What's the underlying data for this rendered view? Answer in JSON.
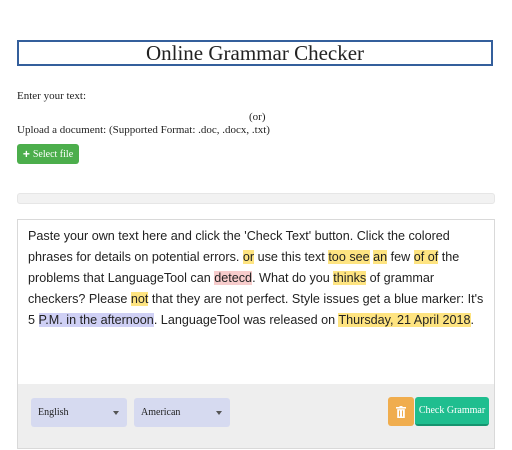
{
  "header": {
    "title": "Online Grammar Checker"
  },
  "input": {
    "enter_label": "Enter your text:",
    "or_label": "(or)",
    "upload_label": "Upload a document: (Supported Format: .doc, .docx, .txt)",
    "select_file_label": "Select file"
  },
  "editor": {
    "segments": [
      {
        "text": "Paste your own text here and click the 'Check Text' button. Click the colored phrases for details on potential errors. ",
        "hl": "none"
      },
      {
        "text": "or",
        "hl": "grammar"
      },
      {
        "text": " use this text ",
        "hl": "none"
      },
      {
        "text": "too see",
        "hl": "grammar"
      },
      {
        "text": " ",
        "hl": "none"
      },
      {
        "text": "an",
        "hl": "grammar"
      },
      {
        "text": " few ",
        "hl": "none"
      },
      {
        "text": "of of",
        "hl": "grammar"
      },
      {
        "text": " the problems that LanguageTool can ",
        "hl": "none"
      },
      {
        "text": "detecd",
        "hl": "spell"
      },
      {
        "text": ". What do you ",
        "hl": "none"
      },
      {
        "text": "thinks",
        "hl": "grammar"
      },
      {
        "text": " of grammar checkers? Please ",
        "hl": "none"
      },
      {
        "text": "not",
        "hl": "grammar"
      },
      {
        "text": " that they are not perfect. Style issues get a blue marker: It's 5 ",
        "hl": "none"
      },
      {
        "text": "P.M. in the afternoon",
        "hl": "style"
      },
      {
        "text": ". LanguageTool was released on ",
        "hl": "none"
      },
      {
        "text": "Thursday, 21 April 2018",
        "hl": "grammar"
      },
      {
        "text": ".",
        "hl": "none"
      }
    ]
  },
  "toolbar": {
    "language_selected": "English",
    "variant_selected": "American",
    "check_label": "Check Grammar",
    "clear_icon": "trash-icon",
    "colors": {
      "check_button": "#1fbe8f",
      "clear_button": "#f0ad4e",
      "select_file_button": "#4cae4c"
    }
  }
}
